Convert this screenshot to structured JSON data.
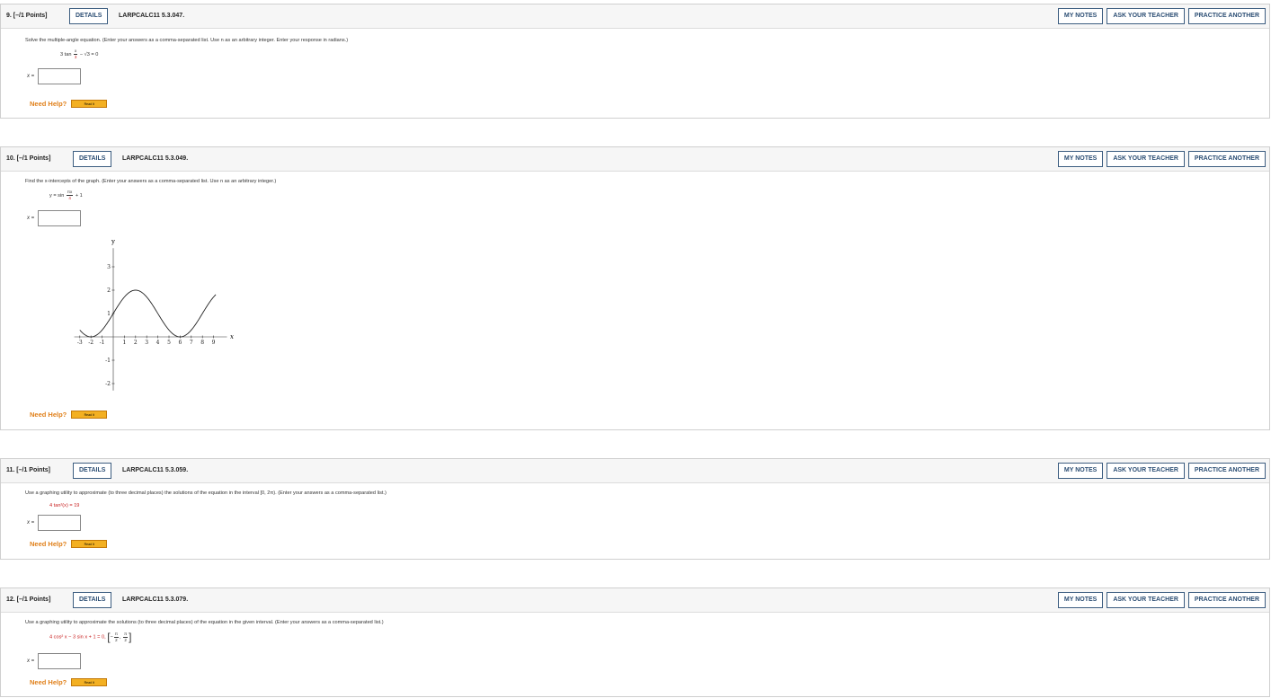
{
  "common": {
    "details_label": "DETAILS",
    "my_notes_label": "MY NOTES",
    "ask_teacher_label": "ASK YOUR TEACHER",
    "practice_label": "PRACTICE ANOTHER",
    "need_help_label": "Need Help?",
    "read_it_label": "Read It",
    "answer_label": "x ="
  },
  "questions": [
    {
      "number": "9.  [–/1 Points]",
      "code": "LARPCALC11 5.3.047.",
      "prompt": "Solve the multiple-angle equation. (Enter your answers as a comma-separated list. Use n as an arbitrary integer. Enter your response in radians.)",
      "eq_prefix": "3 tan",
      "eq_frac_num": "x",
      "eq_frac_den": "3",
      "eq_suffix": "− √3 = 0"
    },
    {
      "number": "10.  [–/1 Points]",
      "code": "LARPCALC11 5.3.049.",
      "prompt": "Find the x-intercepts of the graph. (Enter your answers as a comma-separated list. Use n as an arbitrary integer.)",
      "eq_prefix": "y = sin",
      "eq_frac_num": "πx",
      "eq_frac_den": "4",
      "eq_suffix": "+ 1",
      "graph": {
        "y_axis_label": "y",
        "x_axis_label": "x",
        "x_ticks": [
          "-3",
          "-2",
          "-1",
          "1",
          "2",
          "3",
          "4",
          "5",
          "6",
          "7",
          "8",
          "9"
        ],
        "y_ticks": [
          "3",
          "2",
          "1",
          "-1",
          "-2"
        ]
      }
    },
    {
      "number": "11.  [–/1 Points]",
      "code": "LARPCALC11 5.3.059.",
      "prompt": "Use a graphing utility to approximate (to three decimal places) the solutions of the equation in the interval [0, 2π). (Enter your answers as a comma-separated list.)",
      "eq_text": "4 tan²(x) = 19"
    },
    {
      "number": "12.  [–/1 Points]",
      "code": "LARPCALC11 5.3.079.",
      "prompt": "Use a graphing utility to approximate the solutions (to three decimal places) of the equation in the given interval. (Enter your answers as a comma-separated list.)",
      "eq_text": "4 cos² x − 3 sin x + 1 = 0,",
      "interval_left_num": "π",
      "interval_left_den": "2",
      "interval_right_num": "π",
      "interval_right_den": "2"
    }
  ]
}
